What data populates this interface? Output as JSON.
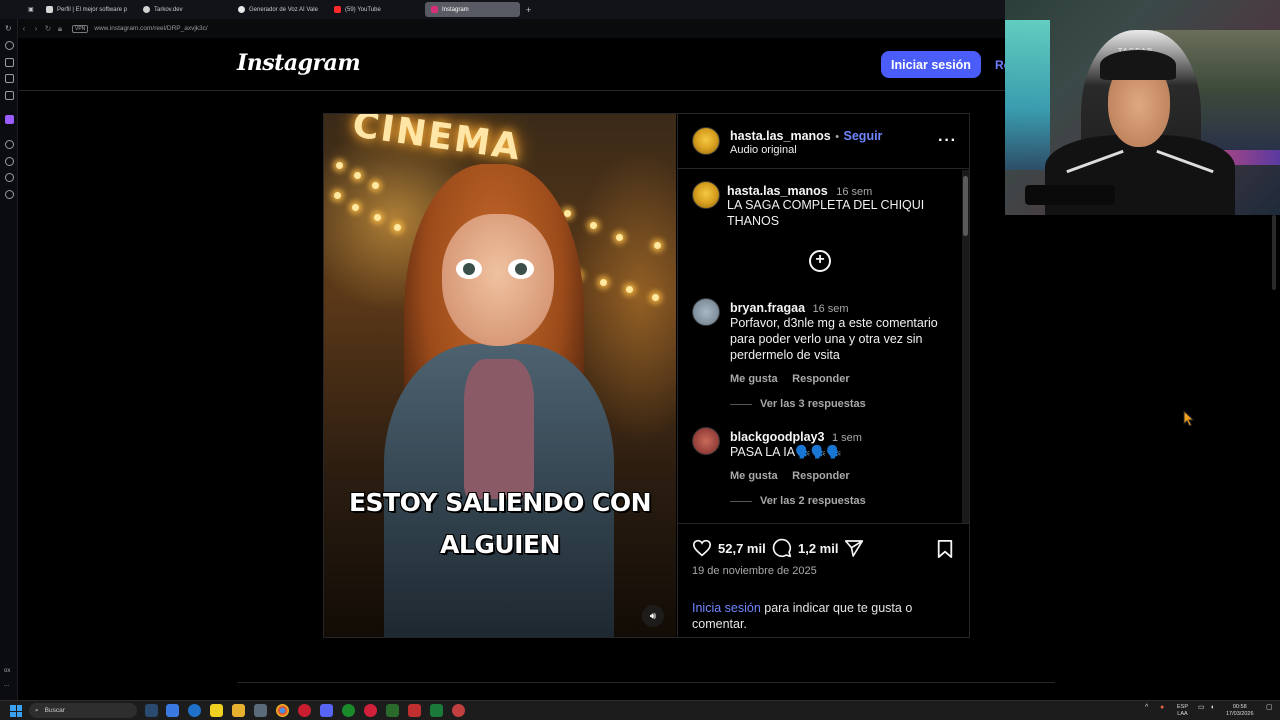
{
  "browser": {
    "tabs": [
      {
        "label": "Perfil | El mejor software p",
        "color": "#d8d8d8"
      },
      {
        "label": "Tarkov.dev",
        "color": "#d0d0d0"
      },
      {
        "label": "Generador de Voz AI Vale",
        "color": "#e8e8e8"
      },
      {
        "label": "(59) YouTube",
        "color": "#ff2a2a"
      },
      {
        "label": "Instagram",
        "color": "#d6307a"
      }
    ],
    "vpn_label": "VPN",
    "url": "www.instagram.com/reel/DRP_axvjk3c/",
    "sidebar_footer": "ox",
    "sidebar_more": "..."
  },
  "instagram": {
    "logo": "Instagram",
    "login_button": "Iniciar sesión",
    "register_link": "Re",
    "post": {
      "author": "hasta.las_manos",
      "separator": "•",
      "follow": "Seguir",
      "audio": "Audio original",
      "more_icon": "ellipsis-icon",
      "video_caption_line1": "ESTOY SALIENDO CON",
      "video_caption_line2": "ALGUIEN",
      "video_sign": "CINEMA",
      "sound_icon": "speaker-icon",
      "caption_comment": {
        "user": "hasta.las_manos",
        "time": "16 sem",
        "text_line1": "LA SAGA COMPLETA DEL CHIQUI",
        "text_line2": "THANOS"
      },
      "add_comment_icon": "plus-circle-icon",
      "comments": [
        {
          "user": "bryan.fragaa",
          "time": "16 sem",
          "lines": [
            "Porfavor, d3nle mg a este comentario",
            "para poder verlo una y otra vez sin",
            "perdermelo de vsita"
          ],
          "like": "Me gusta",
          "reply": "Responder",
          "view_replies": "Ver las 3 respuestas"
        },
        {
          "user": "blackgoodplay3",
          "time": "1 sem",
          "lines": [
            "PASA LA IA🗣️🗣️🗣️"
          ],
          "like": "Me gusta",
          "reply": "Responder",
          "view_replies": "Ver las 2 respuestas"
        }
      ],
      "likes_count": "52,7 mil",
      "comments_count": "1,2 mil",
      "date": "19 de noviembre de 2025",
      "login_note_link": "Inicia sesión",
      "login_note_rest": " para indicar que te gusta o comentar."
    }
  },
  "webcam": {
    "chair_brand": "TAGEAR"
  },
  "taskbar": {
    "search_placeholder": "Buscar",
    "lang_top": "ESP",
    "lang_bottom": "LAA",
    "time": "00:58",
    "date": "17/03/2026"
  },
  "colors": {
    "login_blue": "#4a5df9",
    "link_blue": "#6f86ff",
    "border": "#262626"
  }
}
